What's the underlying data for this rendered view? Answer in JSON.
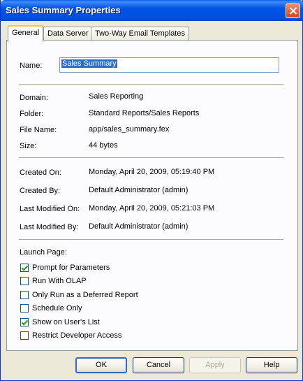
{
  "window": {
    "title": "Sales Summary Properties"
  },
  "tabs": [
    {
      "label": "General"
    },
    {
      "label": "Data Server"
    },
    {
      "label": "Two-Way Email Templates"
    }
  ],
  "general": {
    "name_label": "Name:",
    "name_value": "Sales Summary",
    "info": [
      {
        "label": "Domain:",
        "value": "Sales Reporting"
      },
      {
        "label": "Folder:",
        "value": "Standard Reports/Sales Reports"
      },
      {
        "label": "File Name:",
        "value": "app/sales_summary.fex"
      },
      {
        "label": "Size:",
        "value": "44 bytes"
      }
    ],
    "history": [
      {
        "label": "Created On:",
        "value": "Monday, April 20, 2009, 05:19:40 PM"
      },
      {
        "label": "Created By:",
        "value": "Default Administrator (admin)"
      },
      {
        "label": "Last Modified On:",
        "value": "Monday, April 20, 2009, 05:21:03 PM"
      },
      {
        "label": "Last Modified By:",
        "value": "Default Administrator (admin)"
      }
    ],
    "launch_page_label": "Launch Page:",
    "options": [
      {
        "label": "Prompt for Parameters",
        "checked": true
      },
      {
        "label": "Run With OLAP",
        "checked": false
      },
      {
        "label": "Only Run as a Deferred Report",
        "checked": false
      },
      {
        "label": "Schedule Only",
        "checked": false
      },
      {
        "label": "Show on User's List",
        "checked": true
      },
      {
        "label": "Restrict Developer Access",
        "checked": false
      }
    ]
  },
  "buttons": {
    "ok": "OK",
    "cancel": "Cancel",
    "apply": "Apply",
    "help": "Help"
  }
}
